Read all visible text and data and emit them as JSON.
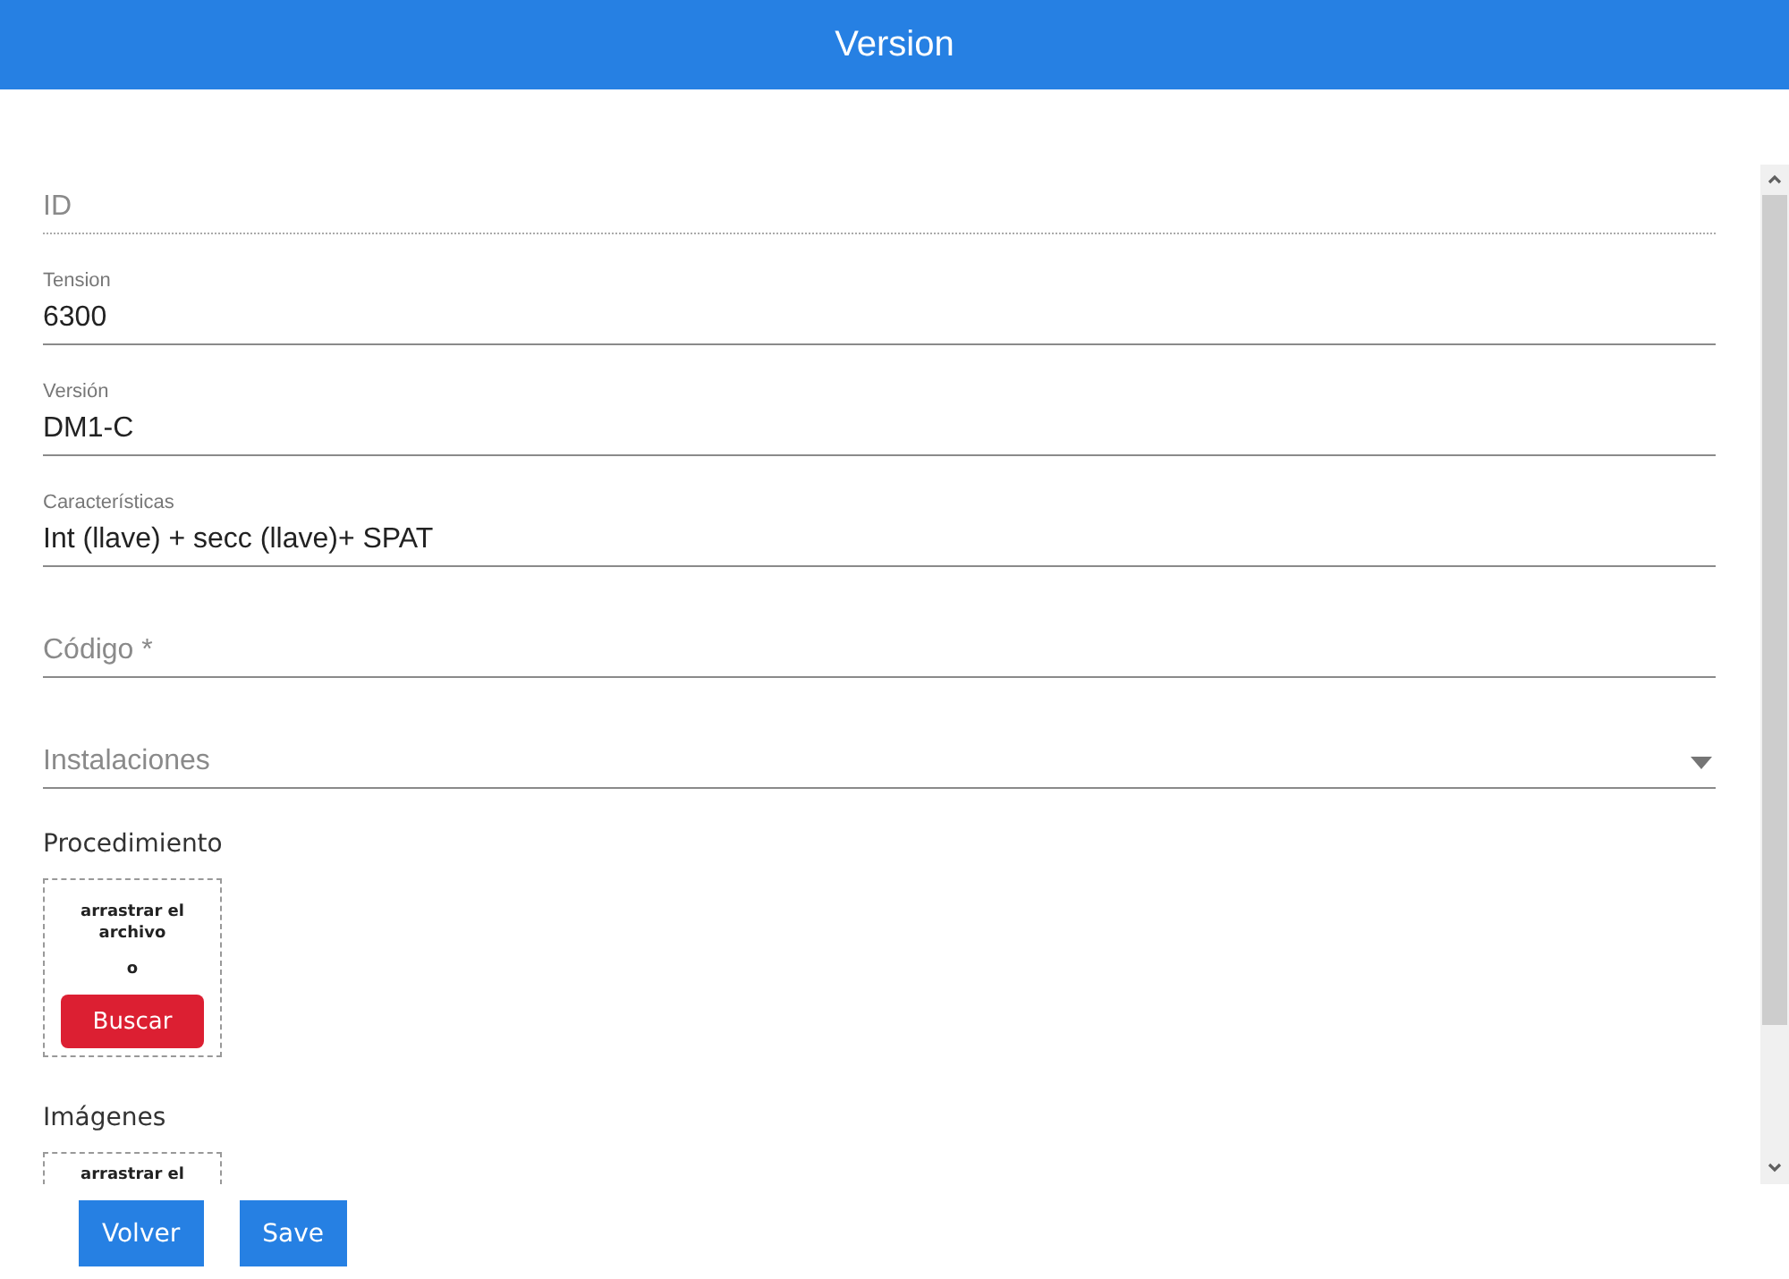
{
  "header": {
    "title": "Version"
  },
  "fields": [
    {
      "kind": "text",
      "placeholder": "ID",
      "disabled": true
    },
    {
      "kind": "text",
      "label": "Tension",
      "value": "6300",
      "disabled": false
    },
    {
      "kind": "text",
      "label": "Versión",
      "value": "DM1-C",
      "disabled": false
    },
    {
      "kind": "text",
      "label": "Características",
      "value": "Int (llave) + secc (llave)+ SPAT",
      "disabled": false
    },
    {
      "kind": "text",
      "placeholder": "Código *",
      "disabled": false
    },
    {
      "kind": "select",
      "placeholder": "Instalaciones",
      "disabled": false
    }
  ],
  "uploads": [
    {
      "label": "Procedimiento",
      "drop_text": "arrastrar el archivo",
      "or_text": "o",
      "button": "Buscar"
    },
    {
      "label": "Imágenes",
      "drop_text": "arrastrar el"
    }
  ],
  "buttons": [
    "Volver",
    "Save"
  ]
}
